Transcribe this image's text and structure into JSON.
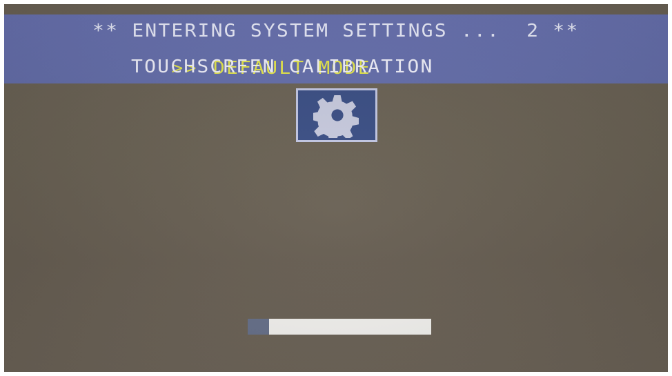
{
  "menu": {
    "title": "** ENTERING SYSTEM SETTINGS ...  2 **",
    "cursor": ">>",
    "selected_item": "DEFAULT MODE",
    "other_item": "TOUCHSCREEN CALIBRATION"
  },
  "icon": {
    "name": "gear-icon"
  },
  "progress": {
    "fraction": 0.115
  },
  "colors": {
    "banner": "#6b74b4",
    "selected_text": "#e7e94e",
    "normal_text": "#f4f4ff",
    "icon_background": "#3b4f86",
    "progress_track": "#f4f3f0",
    "progress_fill": "#66708a"
  }
}
